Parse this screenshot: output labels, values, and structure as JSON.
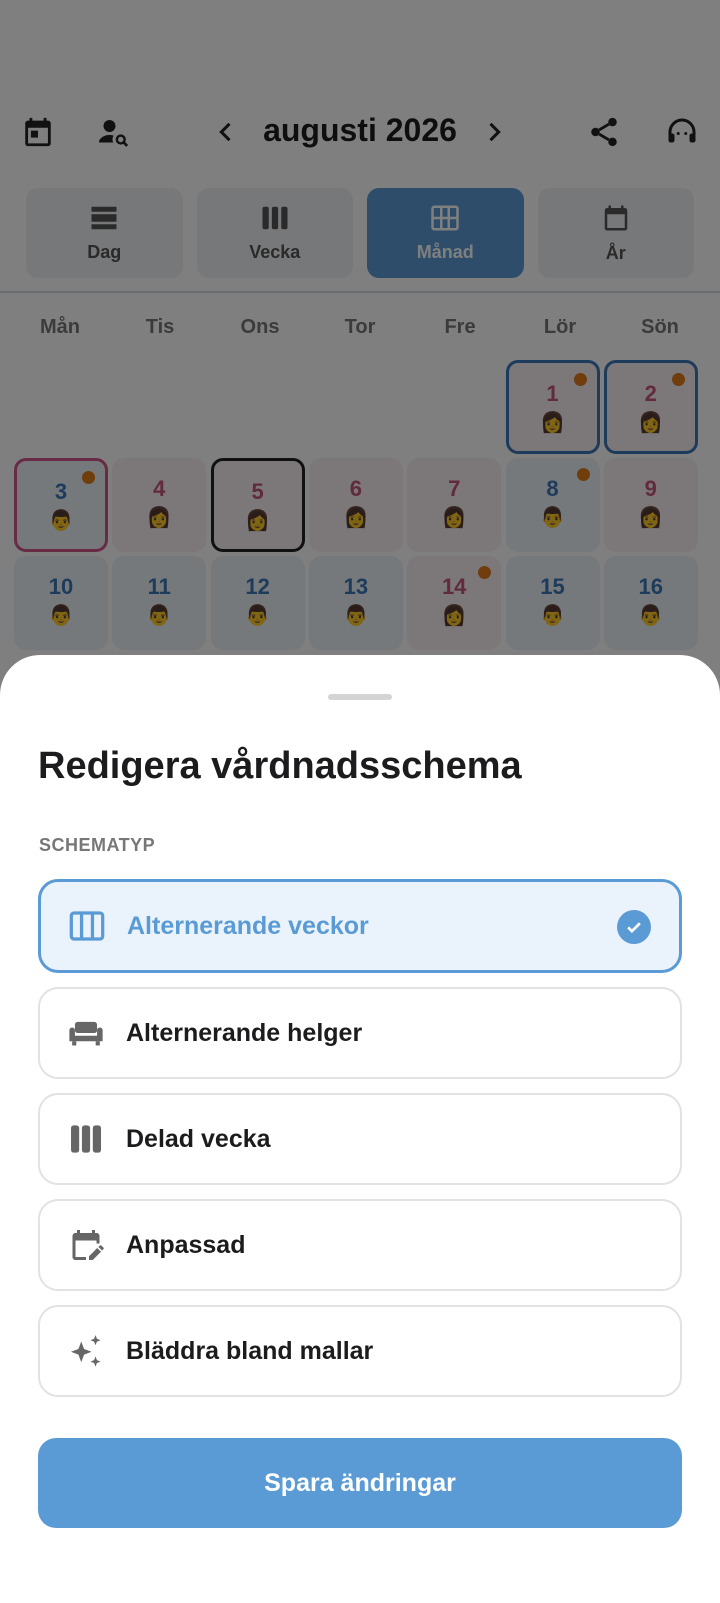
{
  "header": {
    "month_title": "augusti 2026",
    "icons": [
      "calendar-today-icon",
      "person-search-icon",
      "chevron-left-icon",
      "chevron-right-icon",
      "share-icon",
      "support-agent-icon"
    ]
  },
  "view_tabs": [
    {
      "label": "Dag",
      "icon": "day-view-icon",
      "active": false
    },
    {
      "label": "Vecka",
      "icon": "week-view-icon",
      "active": false
    },
    {
      "label": "Månad",
      "icon": "month-view-icon",
      "active": true
    },
    {
      "label": "År",
      "icon": "year-view-icon",
      "active": false
    }
  ],
  "weekdays": [
    "Mån",
    "Tis",
    "Ons",
    "Tor",
    "Fre",
    "Lör",
    "Sön"
  ],
  "calendar": {
    "days": [
      {
        "num": "1",
        "color": "pink",
        "emoji": "👩",
        "dot": true,
        "tint": "pink",
        "outline": "blue"
      },
      {
        "num": "2",
        "color": "pink",
        "emoji": "👩",
        "dot": true,
        "tint": "pink",
        "outline": "blue"
      },
      {
        "num": "3",
        "color": "blue",
        "emoji": "👨",
        "dot": true,
        "tint": "blue",
        "outline": "pink"
      },
      {
        "num": "4",
        "color": "pink",
        "emoji": "👩",
        "dot": false,
        "tint": "pink",
        "outline": ""
      },
      {
        "num": "5",
        "color": "pink",
        "emoji": "👩",
        "dot": false,
        "tint": "pink",
        "outline": "dark"
      },
      {
        "num": "6",
        "color": "pink",
        "emoji": "👩",
        "dot": false,
        "tint": "pink",
        "outline": ""
      },
      {
        "num": "7",
        "color": "pink",
        "emoji": "👩",
        "dot": false,
        "tint": "pink",
        "outline": ""
      },
      {
        "num": "8",
        "color": "blue",
        "emoji": "👨",
        "dot": true,
        "tint": "blue",
        "outline": ""
      },
      {
        "num": "9",
        "color": "pink",
        "emoji": "👩",
        "dot": false,
        "tint": "pink",
        "outline": ""
      },
      {
        "num": "10",
        "color": "blue",
        "emoji": "👨",
        "dot": false,
        "tint": "blue",
        "outline": ""
      },
      {
        "num": "11",
        "color": "blue",
        "emoji": "👨",
        "dot": false,
        "tint": "blue",
        "outline": ""
      },
      {
        "num": "12",
        "color": "blue",
        "emoji": "👨",
        "dot": false,
        "tint": "blue",
        "outline": ""
      },
      {
        "num": "13",
        "color": "blue",
        "emoji": "👨",
        "dot": false,
        "tint": "blue",
        "outline": ""
      },
      {
        "num": "14",
        "color": "pink",
        "emoji": "👩",
        "dot": true,
        "tint": "pink",
        "outline": ""
      },
      {
        "num": "15",
        "color": "blue",
        "emoji": "👨",
        "dot": false,
        "tint": "blue",
        "outline": ""
      },
      {
        "num": "16",
        "color": "blue",
        "emoji": "👨",
        "dot": false,
        "tint": "blue",
        "outline": ""
      }
    ]
  },
  "sheet": {
    "title": "Redigera vårdnadsschema",
    "section_label": "SCHEMATYP",
    "options": [
      {
        "label": "Alternerande veckor",
        "icon": "view-week-icon",
        "selected": true
      },
      {
        "label": "Alternerande helger",
        "icon": "weekend-sofa-icon",
        "selected": false
      },
      {
        "label": "Delad vecka",
        "icon": "split-week-icon",
        "selected": false
      },
      {
        "label": "Anpassad",
        "icon": "edit-calendar-icon",
        "selected": false
      },
      {
        "label": "Bläddra bland mallar",
        "icon": "sparkle-icon",
        "selected": false
      }
    ],
    "save_label": "Spara ändringar"
  },
  "colors": {
    "accent": "#5b9bd5",
    "mother": "#c2567a",
    "father": "#3b76b4",
    "event_dot": "#e07b18"
  }
}
